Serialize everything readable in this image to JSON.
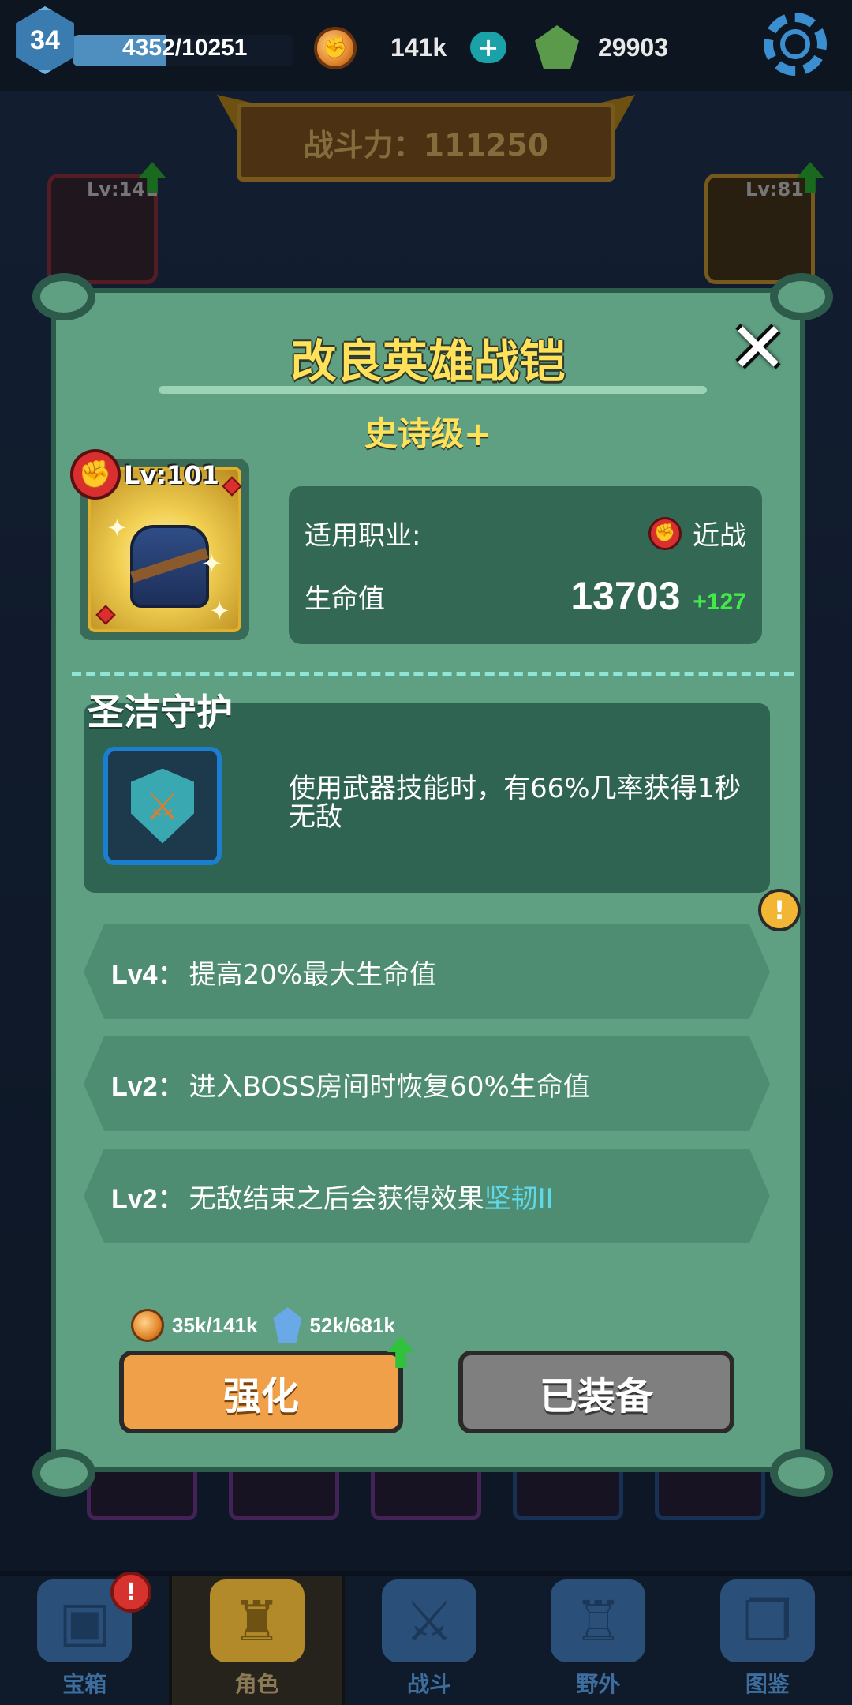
{
  "topbar": {
    "player_level": "34",
    "xp_text": "4352/10251",
    "xp_progress": 0.4245,
    "coins": "141k",
    "gems": "29903"
  },
  "power_banner": {
    "text": "战斗力：111250"
  },
  "background_slots": {
    "left_top_level": "Lv:141",
    "right_top_level": "Lv:81"
  },
  "modal": {
    "title": "改良英雄战铠",
    "rarity": "史诗级+",
    "item_level": "Lv:101",
    "class_label": "适用职业:",
    "class_value": "近战",
    "hp_label": "生命值",
    "hp_value": "13703",
    "hp_bonus": "+127",
    "skill_name": "圣洁守护",
    "skill_desc": "使用武器技能时，有66%几率获得1秒无敌",
    "perks": [
      {
        "prefix": "Lv4：",
        "text": "提高20%最大生命值",
        "highlight": ""
      },
      {
        "prefix": "Lv2：",
        "text": "进入BOSS房间时恢复60%生命值",
        "highlight": ""
      },
      {
        "prefix": "Lv2：",
        "text": "无敌结束之后会获得效果",
        "highlight": "坚韧II"
      }
    ],
    "cost_coins": "35k/141k",
    "cost_gems": "52k/681k",
    "strengthen_label": "强化",
    "equipped_label": "已装备"
  },
  "nav": [
    {
      "label": "宝箱",
      "icon": "chest-icon",
      "active": false
    },
    {
      "label": "角色",
      "icon": "helmet-icon",
      "active": true
    },
    {
      "label": "战斗",
      "icon": "crossed-swords-icon",
      "active": false
    },
    {
      "label": "野外",
      "icon": "castle-icon",
      "active": false
    },
    {
      "label": "图鉴",
      "icon": "book-icon",
      "active": false
    }
  ],
  "colors": {
    "modal_bg": "#5f9f82",
    "title_yellow": "#ffe15a",
    "hp_bonus_green": "#45e84a",
    "highlight_cyan": "#5fd8e8",
    "strengthen_orange": "#f0a048",
    "equipped_gray": "#7f7f7f"
  }
}
